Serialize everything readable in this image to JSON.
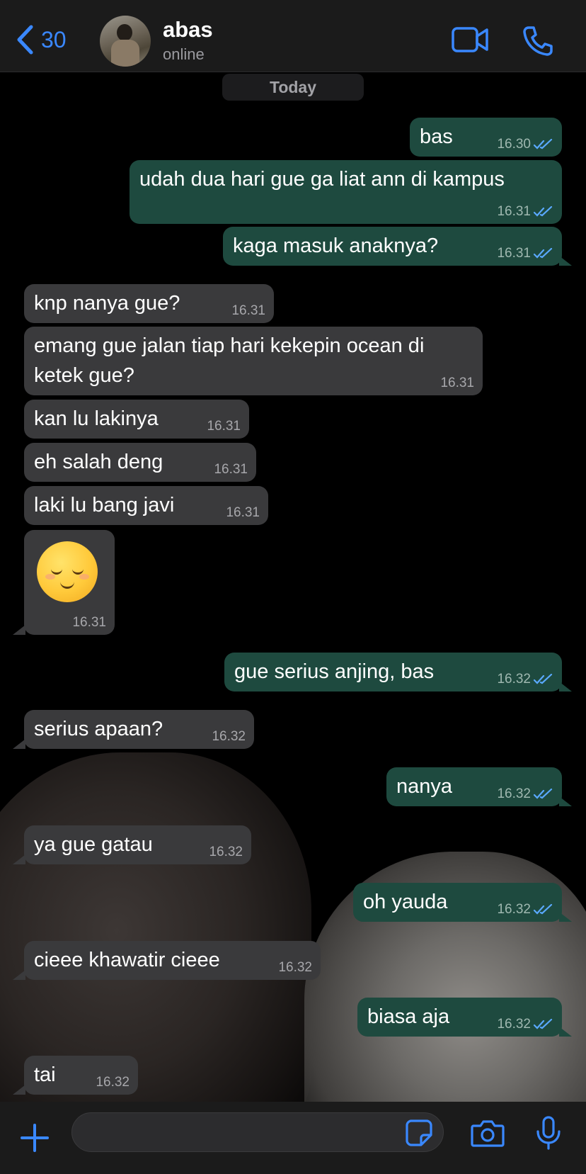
{
  "header": {
    "back_count": "30",
    "contact_name": "abas",
    "contact_status": "online",
    "icons": [
      "chevron-left-icon",
      "video-call-icon",
      "phone-icon"
    ]
  },
  "chat": {
    "date_label": "Today",
    "messages": [
      {
        "dir": "out",
        "text": "bas",
        "time": "16.30",
        "read": true
      },
      {
        "dir": "out",
        "text": "udah dua hari gue ga liat ann di kampus",
        "time": "16.31",
        "read": true
      },
      {
        "dir": "out",
        "text": "kaga masuk anaknya?",
        "time": "16.31",
        "read": true
      },
      {
        "dir": "in",
        "text": "knp nanya gue?",
        "time": "16.31"
      },
      {
        "dir": "in",
        "text": "emang gue jalan tiap hari kekepin ocean di",
        "text2": "ketek gue?",
        "time": "16.31"
      },
      {
        "dir": "in",
        "text": "kan lu lakinya",
        "time": "16.31"
      },
      {
        "dir": "in",
        "text": "eh salah deng",
        "time": "16.31"
      },
      {
        "dir": "in",
        "text": "laki lu bang javi",
        "time": "16.31"
      },
      {
        "dir": "in",
        "emoji": "relieved-face",
        "time": "16.31"
      },
      {
        "dir": "out",
        "text": "gue serius anjing, bas",
        "time": "16.32",
        "read": true
      },
      {
        "dir": "in",
        "text": "serius apaan?",
        "time": "16.32"
      },
      {
        "dir": "out",
        "text": "nanya",
        "time": "16.32",
        "read": true
      },
      {
        "dir": "in",
        "text": "ya gue gatau",
        "time": "16.32"
      },
      {
        "dir": "out",
        "text": "oh yauda",
        "time": "16.32",
        "read": true
      },
      {
        "dir": "in",
        "text": "cieee khawatir cieee",
        "time": "16.32"
      },
      {
        "dir": "out",
        "text": "biasa aja",
        "time": "16.32",
        "read": true
      },
      {
        "dir": "in",
        "text": "tai",
        "time": "16.32"
      }
    ]
  },
  "input": {
    "value": "",
    "placeholder": "",
    "icons": [
      "plus-icon",
      "sticker-icon",
      "camera-icon",
      "microphone-icon"
    ]
  },
  "colors": {
    "accent": "#3a88ff",
    "outgoing_bubble": "#1e4a3f",
    "incoming_bubble": "#3a3a3c",
    "read_ticks": "#5aa9ff"
  }
}
